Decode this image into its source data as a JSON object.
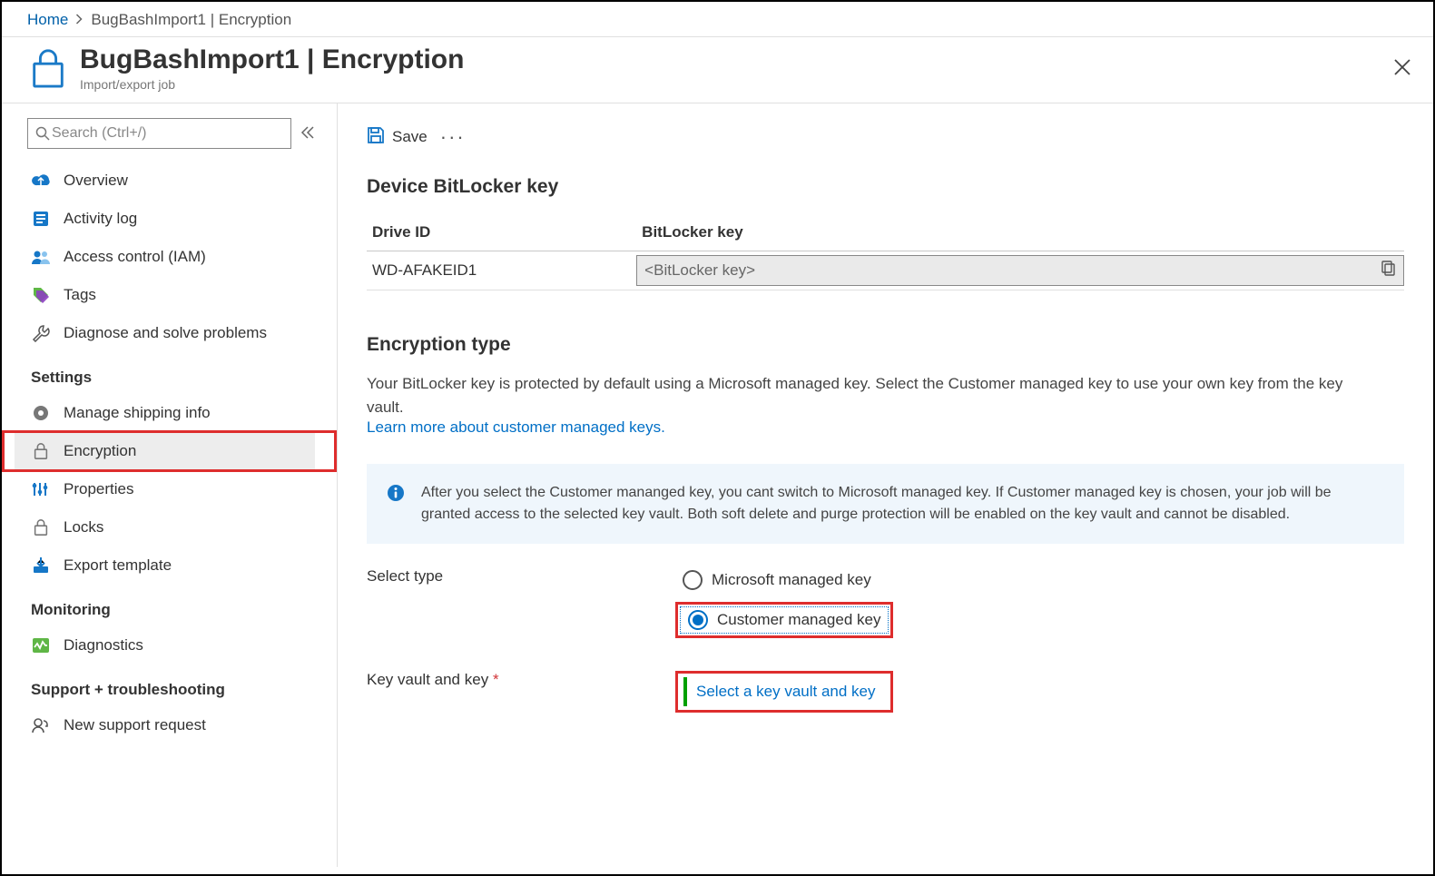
{
  "breadcrumb": {
    "home": "Home",
    "rest": "BugBashImport1 | Encryption"
  },
  "header": {
    "title": "BugBashImport1 | Encryption",
    "subtitle": "Import/export job"
  },
  "sidebar": {
    "search_placeholder": "Search (Ctrl+/)",
    "items_top": [
      {
        "label": "Overview"
      },
      {
        "label": "Activity log"
      },
      {
        "label": "Access control (IAM)"
      },
      {
        "label": "Tags"
      },
      {
        "label": "Diagnose and solve problems"
      }
    ],
    "group_settings": "Settings",
    "items_settings": [
      {
        "label": "Manage shipping info"
      },
      {
        "label": "Encryption",
        "selected": true
      },
      {
        "label": "Properties"
      },
      {
        "label": "Locks"
      },
      {
        "label": "Export template"
      }
    ],
    "group_monitoring": "Monitoring",
    "items_monitoring": [
      {
        "label": "Diagnostics"
      }
    ],
    "group_support": "Support + troubleshooting",
    "items_support": [
      {
        "label": "New support request"
      }
    ]
  },
  "toolbar": {
    "save": "Save"
  },
  "section_bitlocker": {
    "title": "Device BitLocker key",
    "col_drive": "Drive ID",
    "col_key": "BitLocker key",
    "rows": [
      {
        "drive": "WD-AFAKEID1",
        "key": "<BitLocker key>"
      }
    ]
  },
  "section_type": {
    "title": "Encryption type",
    "desc": "Your BitLocker key is protected by default using a Microsoft managed key. Select the Customer managed key to use your own key from the key vault.",
    "learn_more": "Learn more about customer managed keys.",
    "info": "After you select the Customer mananged key, you cant switch to Microsoft managed key. If Customer managed key is chosen, your job will be granted access to the selected key vault. Both soft delete and purge protection will be enabled on the key vault and cannot be disabled.",
    "label_select": "Select type",
    "opt_ms": "Microsoft managed key",
    "opt_cust": "Customer managed key",
    "label_kv": "Key vault and key",
    "kv_select": "Select a key vault and key"
  }
}
